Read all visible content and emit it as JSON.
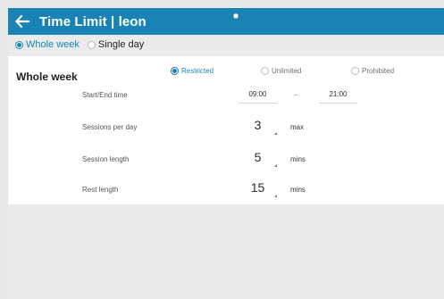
{
  "header": {
    "title": "Time Limit | leon",
    "back_icon": "arrow-left-icon",
    "background": "#1983b5"
  },
  "mode": {
    "options": [
      {
        "label": "Whole week",
        "selected": true
      },
      {
        "label": "Single day",
        "selected": false
      }
    ]
  },
  "section": {
    "title": "Whole week"
  },
  "restriction": {
    "options": [
      {
        "label": "Restricted",
        "selected": true
      },
      {
        "label": "Unlimited",
        "selected": false
      },
      {
        "label": "Prohibited",
        "selected": false
      }
    ]
  },
  "settings": {
    "start_end_label": "Start/End time",
    "start_time": "09:00",
    "end_time": "21:00",
    "sessions_per_day_label": "Sessions per day",
    "sessions_per_day_value": "3",
    "sessions_per_day_unit": "max",
    "session_length_label": "Session length",
    "session_length_value": "5",
    "session_length_unit": "mins",
    "rest_length_label": "Rest length",
    "rest_length_value": "15",
    "rest_length_unit": "mins"
  },
  "colors": {
    "accent": "#1983b5",
    "page_background": "#ebebeb",
    "card_background": "#ffffff"
  }
}
